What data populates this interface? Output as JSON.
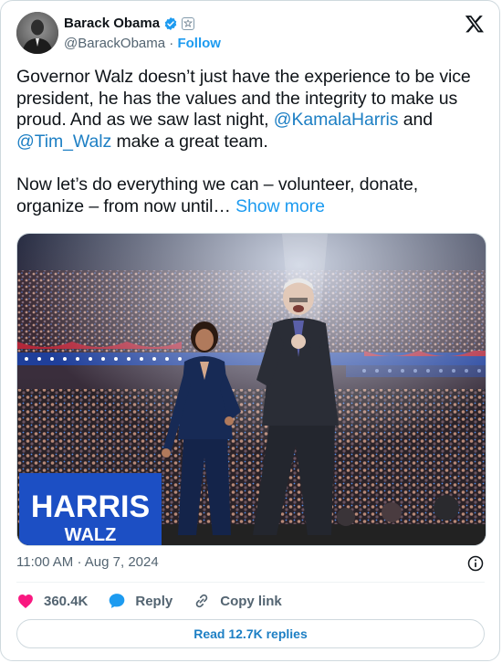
{
  "author": {
    "name": "Barack Obama",
    "handle": "@BarackObama",
    "separator": "·",
    "follow_label": "Follow"
  },
  "tweet": {
    "para1_start": "Governor Walz doesn’t just have the experience to be vice president, he has the values and the integrity to make us proud. And as we saw last night, ",
    "mention1": "@KamalaHarris",
    "para1_mid": " and ",
    "mention2": "@Tim_Walz",
    "para1_end": " make a great team.",
    "para2": "Now let’s do everything we can – volunteer, donate, organize – from now until…",
    "show_more": "Show more"
  },
  "photo": {
    "sign_line1": "HARRIS",
    "sign_line2": "WALZ"
  },
  "meta": {
    "time": "11:00 AM",
    "separator": "·",
    "date": "Aug 7, 2024"
  },
  "actions": {
    "likes": "360.4K",
    "reply_label": "Reply",
    "copy_label": "Copy link"
  },
  "replies_button": "Read 12.7K replies",
  "colors": {
    "accent": "#1d9bf0",
    "like": "#f91880",
    "muted": "#536471"
  },
  "icons": [
    "verified-icon",
    "government-badge-icon",
    "x-logo-icon",
    "info-icon",
    "heart-icon",
    "reply-bubble-icon",
    "link-icon"
  ]
}
